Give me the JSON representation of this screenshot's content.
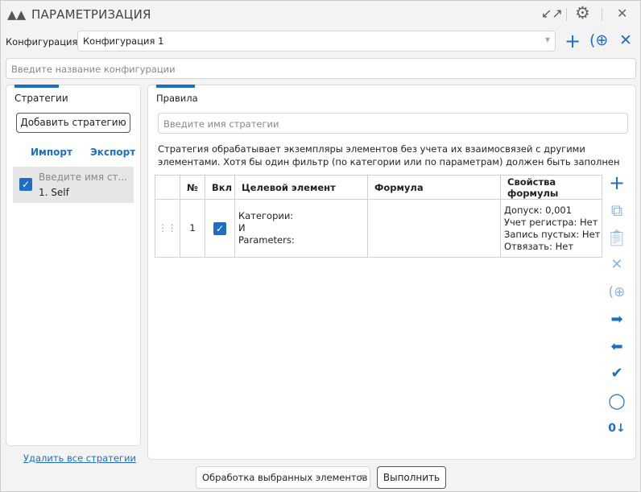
{
  "window": {
    "title": "ПАРАМЕТРИЗАЦИЯ"
  },
  "config": {
    "label": "Конфигурация:",
    "selected": "Конфигурация 1",
    "name_placeholder": "Введите название конфигурации"
  },
  "left": {
    "tab": "Стратегии",
    "add_button": "Добавить стратегию",
    "import": "Импорт",
    "export": "Экспорт",
    "items": [
      {
        "name": "Введите имя ст...",
        "sub": "1. Self",
        "checked": true
      }
    ],
    "delete_all": "Удалить все стратегии"
  },
  "right": {
    "tab": "Правила",
    "strategy_placeholder": "Введите имя стратегии",
    "description": "Стратегия обрабатывает экземпляры элементов без учета их взаимосвязей с другими элементами. Хотя бы один фильтр (по категории или по параметрам) должен быть заполнен",
    "columns": [
      "№",
      "Вкл",
      "Целевой элемент",
      "Формула",
      "Свойства формулы"
    ],
    "rows": [
      {
        "num": "1",
        "enabled": true,
        "target": [
          "Категории:",
          "И",
          "Parameters:"
        ],
        "formula": "",
        "props": [
          "Допуск: 0,001",
          "Учет регистра: Нет",
          "Запись пустых: Нет",
          "Отвязать: Нет"
        ]
      }
    ]
  },
  "footer": {
    "mode": "Обработка выбранных элементов",
    "run": "Выполнить"
  },
  "colors": {
    "accent": "#1e6fc4"
  }
}
